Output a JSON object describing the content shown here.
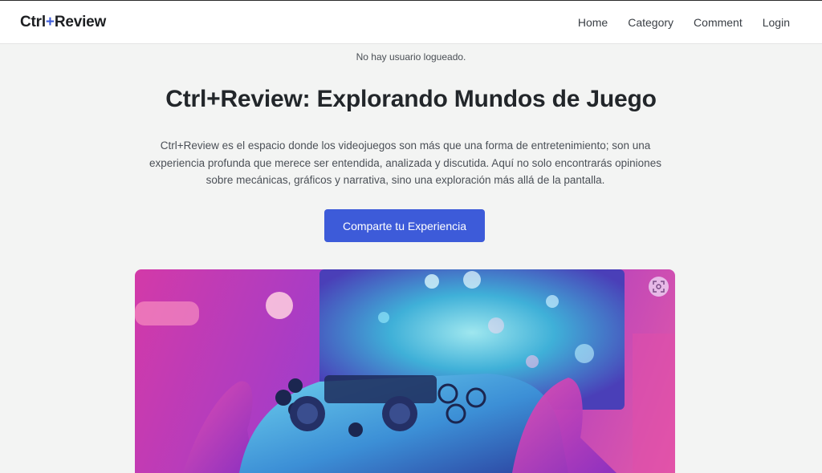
{
  "nav": {
    "brand_prefix": "Ctrl",
    "brand_plus": "+",
    "brand_suffix": "Review",
    "links": [
      "Home",
      "Category",
      "Comment",
      "Login"
    ]
  },
  "status_text": "No hay usuario logueado.",
  "hero": {
    "title": "Ctrl+Review: Explorando Mundos de Juego",
    "description": "Ctrl+Review es el espacio donde los videojuegos son más que una forma de entretenimiento; son una experiencia profunda que merece ser entendida, analizada y discutida. Aquí no solo encontrarás opiniones sobre mecánicas, gráficos y narrativa, sino una exploración más allá de la pantalla.",
    "cta_label": "Comparte tu Experiencia"
  },
  "image": {
    "icon": "zoom-scan-icon"
  },
  "colors": {
    "accent": "#3d5bd9",
    "background": "#f3f4f3"
  }
}
